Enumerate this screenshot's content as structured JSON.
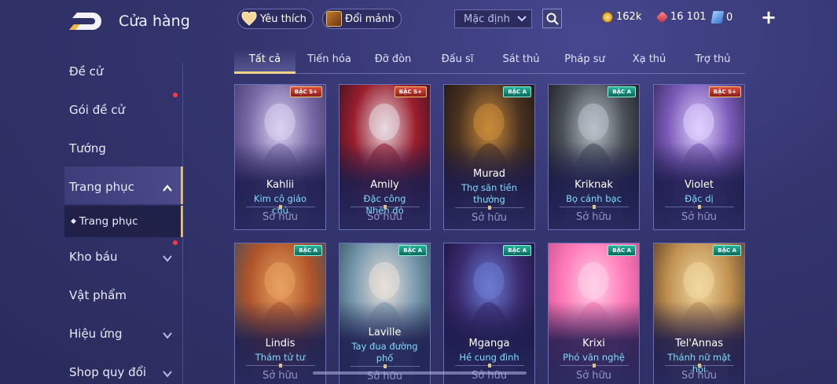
{
  "header": {
    "title": "Cửa hàng",
    "favorites_label": "Yêu thích",
    "exchange_label": "Đổi mảnh",
    "sort_select": "Mặc định",
    "currencies": [
      {
        "icon": "gold-coin-icon",
        "value": "162k"
      },
      {
        "icon": "red-gem-icon",
        "value": "16 101"
      },
      {
        "icon": "voucher-card-icon",
        "value": "0"
      }
    ]
  },
  "sidebar": {
    "items": [
      {
        "label": "Đề cử",
        "dot": false,
        "chevron": ""
      },
      {
        "label": "Gói đề cử",
        "dot": true,
        "chevron": ""
      },
      {
        "label": "Tướng",
        "dot": false,
        "chevron": ""
      },
      {
        "label": "Trang phục",
        "dot": false,
        "chevron": "up"
      },
      {
        "label": "Kho báu",
        "dot": true,
        "chevron": "down"
      },
      {
        "label": "Vật phẩm",
        "dot": false,
        "chevron": ""
      },
      {
        "label": "Hiệu ứng",
        "dot": false,
        "chevron": "down"
      },
      {
        "label": "Shop quy đổi",
        "dot": false,
        "chevron": "down"
      }
    ],
    "sub_item": "Trang phục"
  },
  "tabs": [
    "Tất cả",
    "Tiến hóa",
    "Đỡ đòn",
    "Đấu sĩ",
    "Sát thủ",
    "Pháp sư",
    "Xạ thủ",
    "Trợ thủ"
  ],
  "active_tab": "Tất cả",
  "cards": [
    {
      "hero": "Kahlii",
      "skin": "Kim cô giáo chủ",
      "badge": "BẬC S+",
      "tier": "s",
      "status": "Sở hữu",
      "colors": [
        "#d9d2f0",
        "#7a6aa8",
        "#3a2f60"
      ]
    },
    {
      "hero": "Amily",
      "skin": "Đặc công Nhện đỏ",
      "badge": "BẬC S+",
      "tier": "s",
      "status": "Sở hữu",
      "colors": [
        "#e8d8e0",
        "#9a1e2e",
        "#2a0f1e"
      ]
    },
    {
      "hero": "Murad",
      "skin": "Thợ săn tiền thưởng",
      "badge": "BẬC A",
      "tier": "a",
      "status": "Sở hữu",
      "colors": [
        "#c88a3a",
        "#4a3220",
        "#151015"
      ]
    },
    {
      "hero": "Kriknak",
      "skin": "Bọ cánh bạc",
      "badge": "BẬC A",
      "tier": "a",
      "status": "Sở hữu",
      "colors": [
        "#b8c0c8",
        "#4a5058",
        "#121418"
      ]
    },
    {
      "hero": "Violet",
      "skin": "Đặc dị",
      "badge": "BẬC S+",
      "tier": "s",
      "status": "Sở hữu",
      "colors": [
        "#e0d0ff",
        "#7a5ab8",
        "#2a2048"
      ]
    },
    {
      "hero": "Lindis",
      "skin": "Thám tử tư",
      "badge": "BẬC A",
      "tier": "a",
      "status": "Sở hữu",
      "colors": [
        "#e8a060",
        "#b0552a",
        "#3a4a5a"
      ]
    },
    {
      "hero": "Laville",
      "skin": "Tay đua đường phố",
      "badge": "BẬC A",
      "tier": "a",
      "status": "Sở hữu",
      "colors": [
        "#e8e0d8",
        "#7a9ab0",
        "#2a4a5a"
      ]
    },
    {
      "hero": "Mganga",
      "skin": "Hề cung đình",
      "badge": "BẬC A",
      "tier": "a",
      "status": "Sở hữu",
      "colors": [
        "#6a7ad0",
        "#3a2a70",
        "#151030"
      ]
    },
    {
      "hero": "Krixi",
      "skin": "Phó văn nghệ",
      "badge": "BẬC A",
      "tier": "a",
      "status": "Sở hữu",
      "colors": [
        "#ffd0e8",
        "#ff7ab8",
        "#c04a8a"
      ]
    },
    {
      "hero": "Tel'Annas",
      "skin": "Thánh nữ mặt hội",
      "badge": "BẬC A",
      "tier": "a",
      "status": "Sở hữu",
      "colors": [
        "#f0d8a0",
        "#c09050",
        "#4a3020"
      ]
    }
  ]
}
